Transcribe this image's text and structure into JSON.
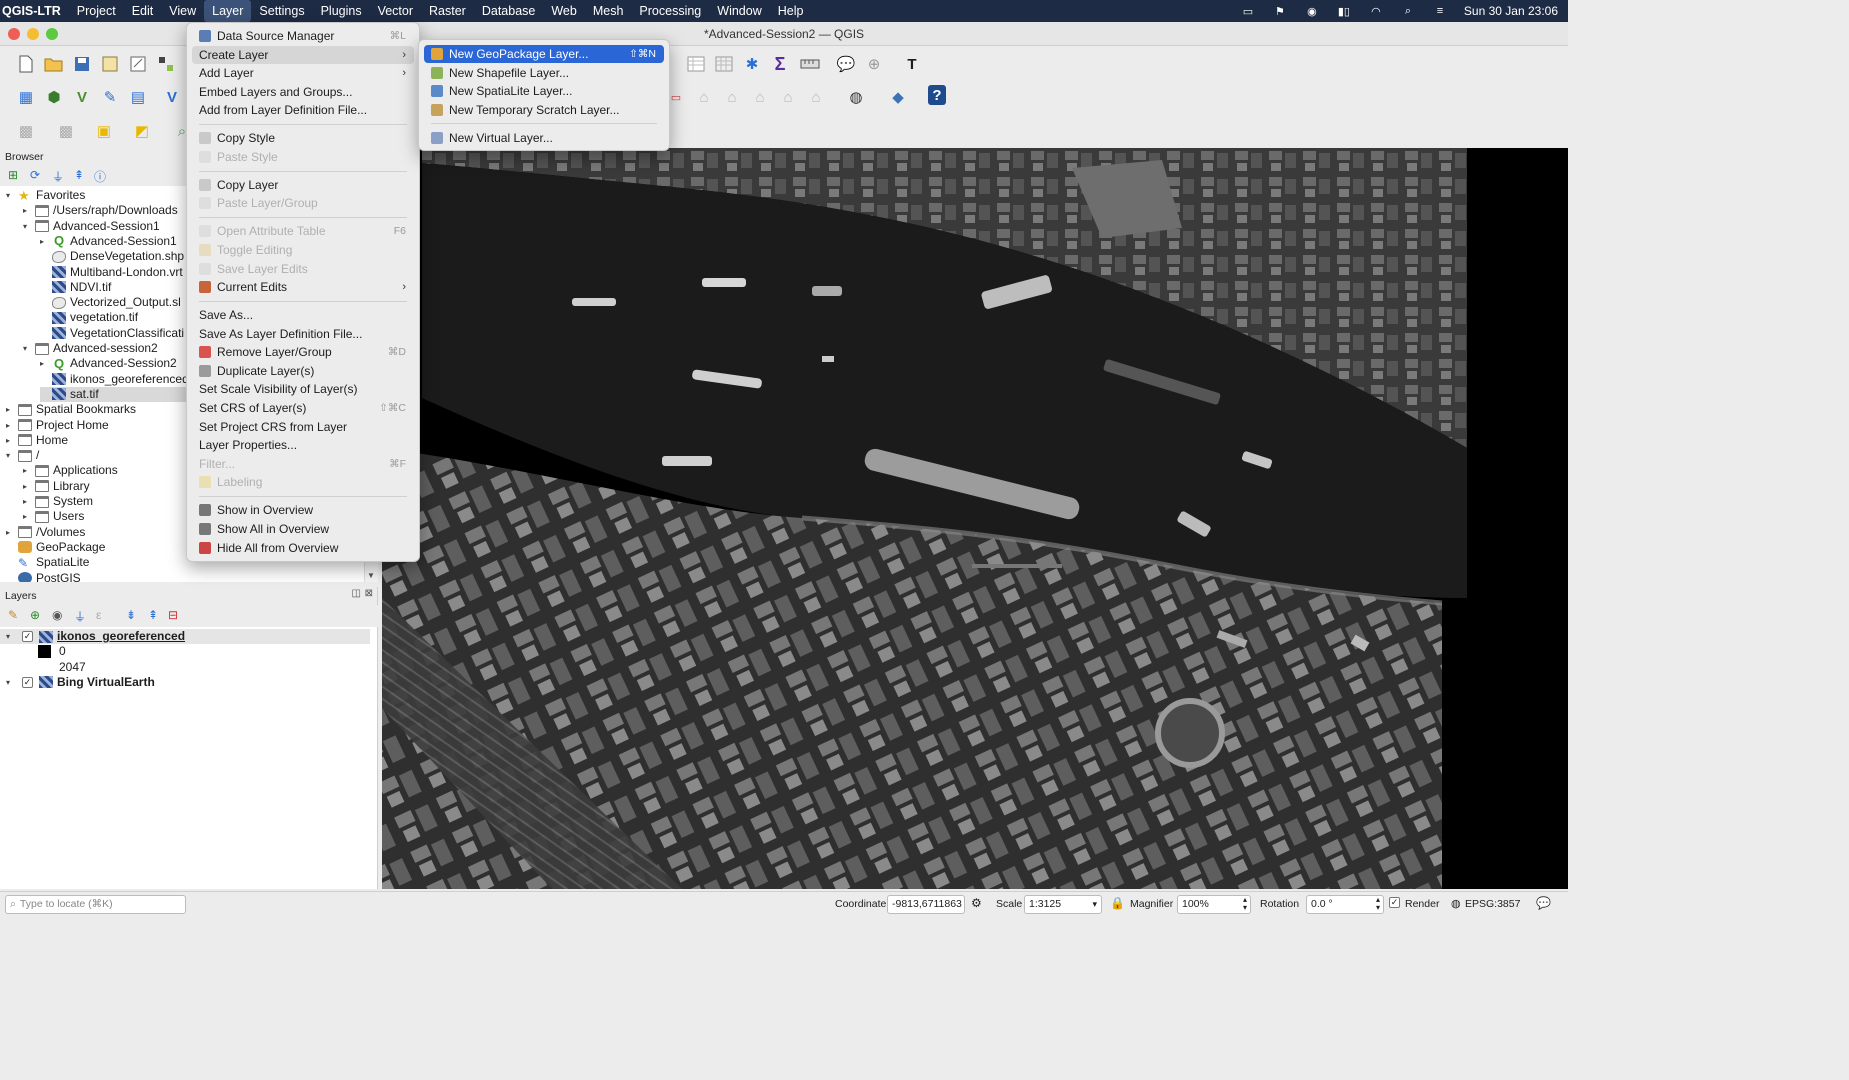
{
  "menubar": {
    "app": "QGIS-LTR",
    "items": [
      "Project",
      "Edit",
      "View",
      "Layer",
      "Settings",
      "Plugins",
      "Vector",
      "Raster",
      "Database",
      "Web",
      "Mesh",
      "Processing",
      "Window",
      "Help"
    ],
    "datetime": "Sun 30 Jan  23:06"
  },
  "window": {
    "title": "*Advanced-Session2 — QGIS"
  },
  "browser": {
    "title": "Browser",
    "tree": [
      {
        "label": "Favorites",
        "indent": 0,
        "arrow": "▾",
        "icon": "star"
      },
      {
        "label": "/Users/raph/Downloads",
        "indent": 1,
        "arrow": "▸",
        "icon": "folder"
      },
      {
        "label": "Advanced-Session1",
        "indent": 1,
        "arrow": "▾",
        "icon": "folder"
      },
      {
        "label": "Advanced-Session1",
        "indent": 2,
        "arrow": "▸",
        "icon": "qgs"
      },
      {
        "label": "DenseVegetation.shp",
        "indent": 2,
        "arrow": "",
        "icon": "vec"
      },
      {
        "label": "Multiband-London.vrt",
        "indent": 2,
        "arrow": "",
        "icon": "raster"
      },
      {
        "label": "NDVI.tif",
        "indent": 2,
        "arrow": "",
        "icon": "raster"
      },
      {
        "label": "Vectorized_Output.sl",
        "indent": 2,
        "arrow": "",
        "icon": "vec"
      },
      {
        "label": "vegetation.tif",
        "indent": 2,
        "arrow": "",
        "icon": "raster"
      },
      {
        "label": "VegetationClassificati",
        "indent": 2,
        "arrow": "",
        "icon": "raster"
      },
      {
        "label": "Advanced-session2",
        "indent": 1,
        "arrow": "▾",
        "icon": "folder"
      },
      {
        "label": "Advanced-Session2",
        "indent": 2,
        "arrow": "▸",
        "icon": "qgs"
      },
      {
        "label": "ikonos_georeferenced",
        "indent": 2,
        "arrow": "",
        "icon": "raster"
      },
      {
        "label": "sat.tif",
        "indent": 2,
        "arrow": "",
        "icon": "raster",
        "selected": true
      },
      {
        "label": "Spatial Bookmarks",
        "indent": 0,
        "arrow": "▸",
        "icon": "folder"
      },
      {
        "label": "Project Home",
        "indent": 0,
        "arrow": "▸",
        "icon": "folder"
      },
      {
        "label": "Home",
        "indent": 0,
        "arrow": "▸",
        "icon": "folder"
      },
      {
        "label": "/",
        "indent": 0,
        "arrow": "▾",
        "icon": "folder"
      },
      {
        "label": "Applications",
        "indent": 1,
        "arrow": "▸",
        "icon": "folder"
      },
      {
        "label": "Library",
        "indent": 1,
        "arrow": "▸",
        "icon": "folder"
      },
      {
        "label": "System",
        "indent": 1,
        "arrow": "▸",
        "icon": "folder"
      },
      {
        "label": "Users",
        "indent": 1,
        "arrow": "▸",
        "icon": "folder"
      },
      {
        "label": "/Volumes",
        "indent": 0,
        "arrow": "▸",
        "icon": "folder"
      },
      {
        "label": "GeoPackage",
        "indent": 0,
        "arrow": "",
        "icon": "gpkg"
      },
      {
        "label": "SpatiaLite",
        "indent": 0,
        "arrow": "",
        "icon": "spatialite"
      },
      {
        "label": "PostGIS",
        "indent": 0,
        "arrow": "",
        "icon": "postgis"
      }
    ]
  },
  "layers": {
    "title": "Layers",
    "items": [
      {
        "label": "ikonos_georeferenced",
        "checked": true,
        "bold": true,
        "underline": true
      },
      {
        "legend": "0"
      },
      {
        "legend": "2047"
      },
      {
        "label": "Bing VirtualEarth",
        "checked": true,
        "bold": true
      }
    ]
  },
  "layer_menu": {
    "items": [
      {
        "label": "Data Source Manager",
        "shortcut": "⌘L",
        "icon": "#5a7db5"
      },
      {
        "label": "Create Layer",
        "submenu": true,
        "active": true
      },
      {
        "label": "Add Layer",
        "submenu": true
      },
      {
        "label": "Embed Layers and Groups..."
      },
      {
        "label": "Add from Layer Definition File..."
      },
      {
        "sep": true
      },
      {
        "label": "Copy Style",
        "icon": "#c9c9c9"
      },
      {
        "label": "Paste Style",
        "disabled": true,
        "icon": "#dedede"
      },
      {
        "sep": true
      },
      {
        "label": "Copy Layer",
        "icon": "#c9c9c9"
      },
      {
        "label": "Paste Layer/Group",
        "disabled": true,
        "icon": "#dedede"
      },
      {
        "sep": true
      },
      {
        "label": "Open Attribute Table",
        "shortcut": "F6",
        "disabled": true,
        "icon": "#dedede"
      },
      {
        "label": "Toggle Editing",
        "disabled": true,
        "icon": "#e8dcc0"
      },
      {
        "label": "Save Layer Edits",
        "disabled": true,
        "icon": "#dedede"
      },
      {
        "label": "Current Edits",
        "submenu": true,
        "icon": "#c8643c"
      },
      {
        "sep": true
      },
      {
        "label": "Save As..."
      },
      {
        "label": "Save As Layer Definition File..."
      },
      {
        "label": "Remove Layer/Group",
        "shortcut": "⌘D",
        "icon": "#d9534f"
      },
      {
        "label": "Duplicate Layer(s)",
        "icon": "#9a9a9a"
      },
      {
        "label": "Set Scale Visibility of Layer(s)"
      },
      {
        "label": "Set CRS of Layer(s)",
        "shortcut": "⇧⌘C"
      },
      {
        "label": "Set Project CRS from Layer"
      },
      {
        "label": "Layer Properties..."
      },
      {
        "label": "Filter...",
        "shortcut": "⌘F",
        "disabled": true
      },
      {
        "label": "Labeling",
        "disabled": true,
        "icon": "#eadfb0"
      },
      {
        "sep": true
      },
      {
        "label": "Show in Overview",
        "icon": "#777"
      },
      {
        "label": "Show All in Overview",
        "icon": "#777"
      },
      {
        "label": "Hide All from Overview",
        "icon": "#c44"
      }
    ]
  },
  "create_layer_menu": {
    "items": [
      {
        "label": "New GeoPackage Layer...",
        "shortcut": "⇧⌘N",
        "highlight": true,
        "icon": "#e0a43a"
      },
      {
        "label": "New Shapefile Layer...",
        "icon": "#8db35a"
      },
      {
        "label": "New SpatiaLite Layer...",
        "icon": "#5a8bc7"
      },
      {
        "label": "New Temporary Scratch Layer...",
        "icon": "#c7a25a"
      },
      {
        "sep": true
      },
      {
        "label": "New Virtual Layer...",
        "icon": "#8aa0c7"
      }
    ]
  },
  "statusbar": {
    "locate_placeholder": "Type to locate (⌘K)",
    "coordinate_label": "Coordinate",
    "coordinate": "-9813,6711863",
    "scale_label": "Scale",
    "scale": "1:3125",
    "magnifier_label": "Magnifier",
    "magnifier": "100%",
    "rotation_label": "Rotation",
    "rotation": "0.0 °",
    "render_label": "Render",
    "crs": "EPSG:3857"
  }
}
